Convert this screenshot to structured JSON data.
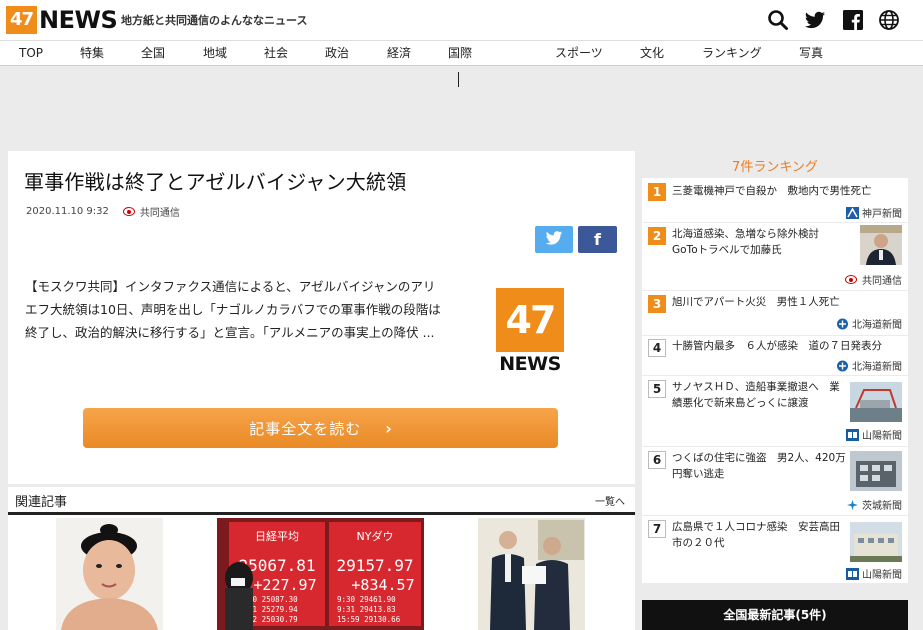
{
  "header": {
    "logo_badge": "47",
    "logo_word": "NEWS",
    "tagline": "地方紙と共同通信のよんななニュース",
    "icons": [
      "search-icon",
      "twitter-icon",
      "facebook-icon",
      "globe-icon"
    ]
  },
  "nav": {
    "items": [
      "TOP",
      "特集",
      "全国",
      "地域",
      "社会",
      "政治",
      "経済",
      "国際",
      "スポーツ",
      "文化",
      "ランキング",
      "写真"
    ]
  },
  "article": {
    "title": "軍事作戦は終了とアゼルバイジャン大統領",
    "date": "2020.11.10 9:32",
    "source": "共同通信",
    "body": "【モスクワ共同】インタファクス通信によると、アゼルバイジャンのアリエフ大統領は10日、声明を出し「ナゴルノカラバフでの軍事作戦の段階は終了し、政治的解決に移行する」と宣言。「アルメニアの事実上の降伏 ...",
    "thumb_badge": "47",
    "thumb_word": "NEWS",
    "read_more": "記事全文を読む",
    "read_more_chevron": "›",
    "share": {
      "facebook_glyph": "f"
    }
  },
  "related": {
    "title": "関連記事",
    "more": "一覧へ",
    "stock_board": {
      "left_label": "日経平均",
      "left_value": "25067.81",
      "left_change": "+227.97",
      "right_label": "NYダウ",
      "right_value": "29157.97",
      "right_change": "+834.57",
      "left_rows": [
        "9:00  25087.30",
        "9:01  25279.94",
        "9:02  25030.79"
      ],
      "right_rows": [
        "9:30  29461.90",
        "9:31  29413.83",
        "15:59  29130.66"
      ]
    }
  },
  "ranking": {
    "title": "7件ランキング",
    "items": [
      {
        "rank": "1",
        "title": "三菱電機神戸で自殺か　敷地内で男性死亡",
        "source": "神戸新聞"
      },
      {
        "rank": "2",
        "title": "北海道感染、急増なら除外検討　GoToトラベルで加藤氏",
        "source": "共同通信"
      },
      {
        "rank": "3",
        "title": "旭川でアパート火災　男性１人死亡",
        "source": "北海道新聞"
      },
      {
        "rank": "4",
        "title": "十勝管内最多　６人が感染　道の７日発表分",
        "source": "北海道新聞"
      },
      {
        "rank": "5",
        "title": "サノヤスＨＤ、造船事業撤退へ　業績悪化で新来島どっくに譲渡",
        "source": "山陽新聞"
      },
      {
        "rank": "6",
        "title": "つくばの住宅に強盗　男2人、420万円奪い逃走",
        "source": "茨城新聞"
      },
      {
        "rank": "7",
        "title": "広島県で１人コロナ感染　安芸高田市の２０代",
        "source": "山陽新聞"
      }
    ],
    "latest_bar": "全国最新記事(5件)"
  },
  "colors": {
    "brand_orange": "#f08c19",
    "twitter": "#55acee",
    "facebook": "#3b5998"
  }
}
